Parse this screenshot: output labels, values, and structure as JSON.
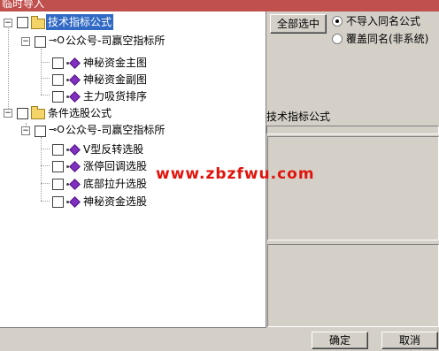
{
  "window": {
    "title": "临时导入"
  },
  "tree": {
    "categories": [
      {
        "label": "技术指标公式",
        "groups": [
          {
            "label": "公众号-司赢空指标所",
            "items": [
              "神秘资金主图",
              "神秘资金副图",
              "主力吸货排序"
            ]
          }
        ]
      },
      {
        "label": "条件选股公式",
        "groups": [
          {
            "label": "公众号-司赢空指标所",
            "items": [
              "V型反转选股",
              "涨停回调选股",
              "底部拉升选股",
              "神秘资金选股"
            ]
          }
        ]
      }
    ]
  },
  "buttons": {
    "select_all": "全部选中",
    "ok": "确定",
    "cancel": "取消"
  },
  "options": {
    "import_mode": [
      {
        "label": "不导入同名公式",
        "checked": true
      },
      {
        "label": "覆盖同名(非系统)",
        "checked": false
      }
    ]
  },
  "info": {
    "header": "技术指标公式"
  },
  "watermark": "www.zbzfwu.com"
}
